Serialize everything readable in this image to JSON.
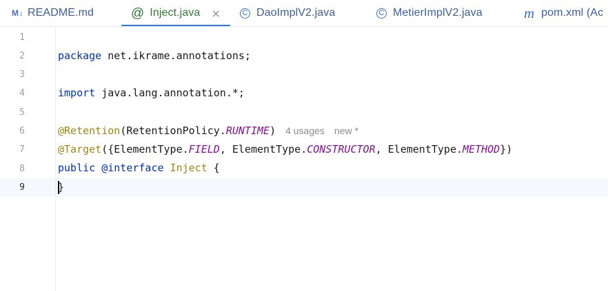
{
  "tabs": [
    {
      "icon": "markdown-icon",
      "icon_text": "M↓",
      "label": "README.md"
    },
    {
      "icon": "annotation-icon",
      "icon_text": "@",
      "label": "Inject.java",
      "active": true,
      "close": "×"
    },
    {
      "icon": "class-icon",
      "icon_text": "C",
      "label": "DaoImplV2.java"
    },
    {
      "icon": "class-icon",
      "icon_text": "C",
      "label": "MetierImplV2.java"
    },
    {
      "icon": "maven-icon",
      "icon_text": "m",
      "label": "pom.xml (Ac"
    }
  ],
  "editor": {
    "line_numbers": [
      "1",
      "2",
      "3",
      "4",
      "5",
      "6",
      "7",
      "8",
      "9"
    ],
    "current_line": 9,
    "lines": {
      "l1": {
        "kw": "package",
        "rest": " net.ikrame.annotations;"
      },
      "l3": {
        "kw": "import",
        "rest": " java.lang.annotation.*;"
      },
      "l5": {
        "ann": "@Retention",
        "open": "(RetentionPolicy.",
        "cst": "RUNTIME",
        "close": ")",
        "hint_usages": "4 usages",
        "hint_new": "new *"
      },
      "l6": {
        "ann": "@Target",
        "p1": "({ElementType.",
        "c1": "FIELD",
        "p2": ", ElementType.",
        "c2": "CONSTRUCTOR",
        "p3": ", ElementType.",
        "c3": "METHOD",
        "p4": "})"
      },
      "l7": {
        "kw1": "public",
        "sp": " ",
        "kw2": "@interface",
        "sp2": " ",
        "name": "Inject",
        "brace": " {"
      },
      "l8": {
        "text": "}"
      }
    }
  },
  "colors": {
    "keyword": "#0033b3",
    "annotation": "#9e880d",
    "constant": "#871094",
    "active_tab": "#2e7d32",
    "tab_underline": "#3574f0"
  }
}
